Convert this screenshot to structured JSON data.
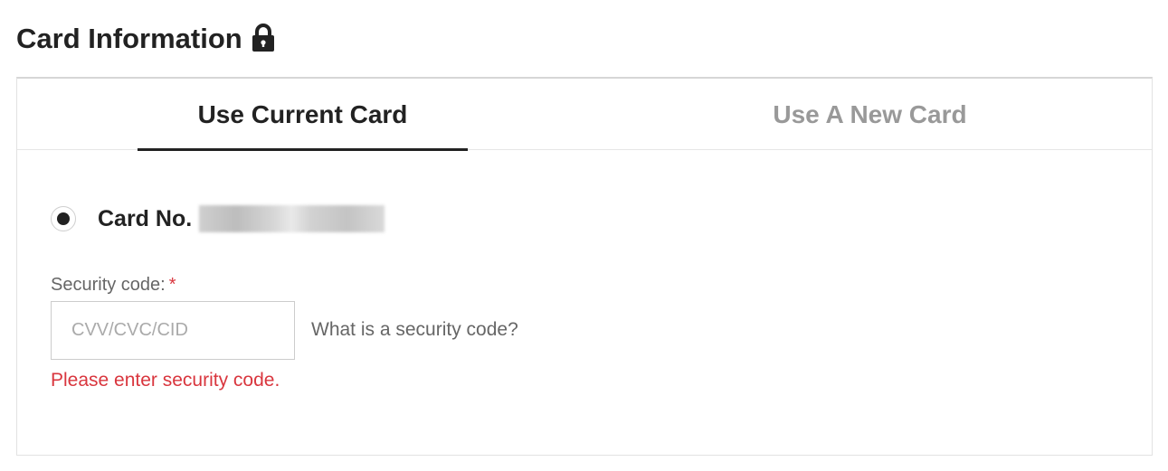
{
  "header": {
    "title": "Card Information"
  },
  "tabs": [
    {
      "label": "Use Current Card",
      "active": true
    },
    {
      "label": "Use A New Card",
      "active": false
    }
  ],
  "current_card": {
    "label": "Card No.",
    "selected": true
  },
  "security": {
    "label": "Security code:",
    "required_mark": "*",
    "placeholder": "CVV/CVC/CID",
    "value": "",
    "help_link": "What is a security code?",
    "error": "Please enter security code."
  },
  "colors": {
    "title": "#222222",
    "inactive_tab": "#999999",
    "error": "#d9363e",
    "muted_text": "#666666"
  }
}
